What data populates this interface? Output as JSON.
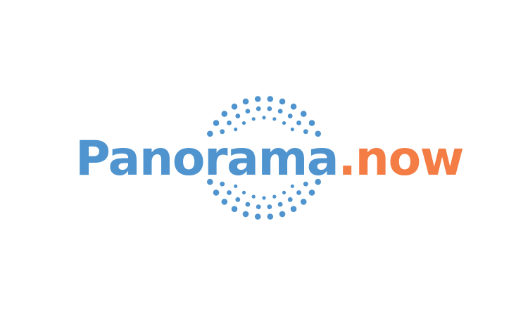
{
  "logo": {
    "name_part": "Panorama",
    "suffix_part": ".now",
    "colors": {
      "primary": "#4f94ce",
      "accent": "#f47c45",
      "dots": "#4f94ce",
      "background": "#ffffff"
    },
    "emblem_icon": "dotted-circle-burst-icon"
  }
}
